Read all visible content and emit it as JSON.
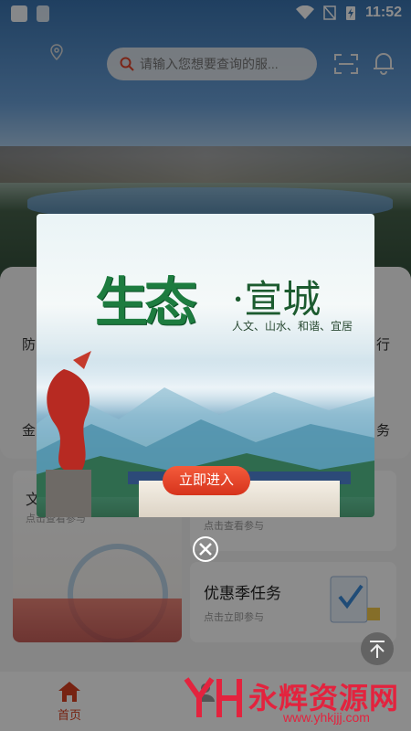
{
  "status_bar": {
    "time": "11:52"
  },
  "search": {
    "placeholder": "请输入您想要查询的服..."
  },
  "background_peek": {
    "left_1": "防",
    "right_1": "行",
    "left_2": "金",
    "right_2": "务",
    "lower_left_title": "文",
    "lower_left_sub": "点击查看参与"
  },
  "cards": [
    {
      "title": "",
      "subtitle": "点击查看参与"
    },
    {
      "title": "优惠季任务",
      "subtitle": "点击立即参与"
    }
  ],
  "modal": {
    "title_big": "生态",
    "title_rest": "·宣城",
    "subtitle": "人文、山水、和谐、宜居",
    "enter_button": "立即进入"
  },
  "bottom_nav": {
    "home_label": "首页",
    "second_label": ""
  },
  "watermark": {
    "text": "永辉资源网",
    "url": "www.yhkjjj.com"
  },
  "colors": {
    "accent": "#d94021",
    "modal_green": "#1d7c3f"
  }
}
